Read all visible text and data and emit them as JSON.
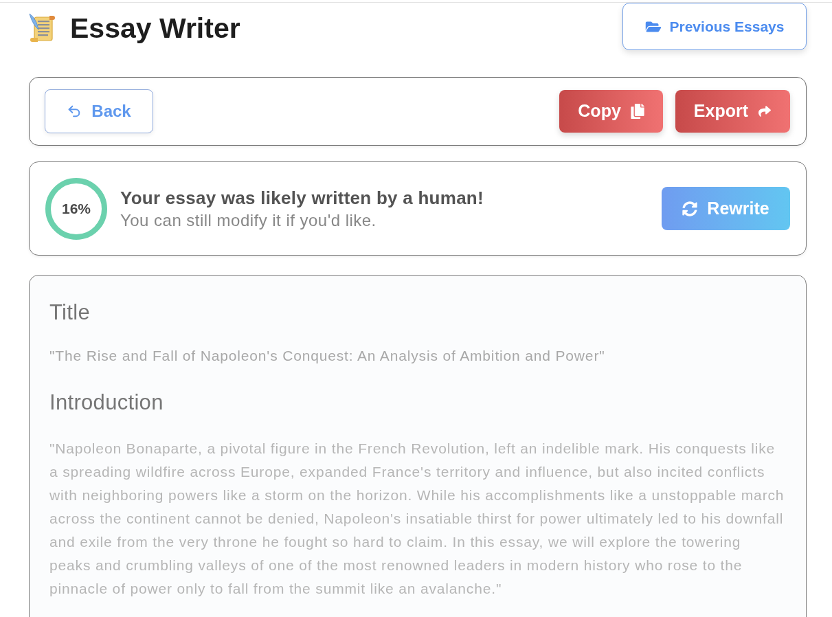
{
  "header": {
    "title": "Essay Writer",
    "previous_button": "Previous Essays"
  },
  "toolbar": {
    "back_button": "Back",
    "actions": [
      {
        "label": "Copy",
        "kind": "copy"
      },
      {
        "label": "Export",
        "kind": "export"
      }
    ]
  },
  "detection": {
    "score": "16%",
    "heading": "Your essay was likely written by a human!",
    "subtext": "You can still modify it if you'd like.",
    "button": "Rewrite"
  },
  "essay": {
    "sections": [
      {
        "heading": "Title",
        "body": "\"The Rise and Fall of Napoleon's Conquest: An Analysis of Ambition and Power\""
      },
      {
        "heading": "Introduction",
        "body": "\"Napoleon Bonaparte, a pivotal figure in the French Revolution, left an indelible mark. His conquests like a spreading wildfire across Europe, expanded France's territory and influence, but also incited conflicts with neighboring powers like a storm on the horizon. While his accomplishments like a unstoppable march across the continent cannot be denied, Napoleon's insatiable thirst for power ultimately led to his downfall and exile from the very throne he fought so hard to claim. In this essay, we will explore the towering peaks and crumbling valleys of one of the most renowned leaders in modern history who rose to the pinnacle of power only to fall from the summit like an avalanche.\""
      }
    ]
  }
}
